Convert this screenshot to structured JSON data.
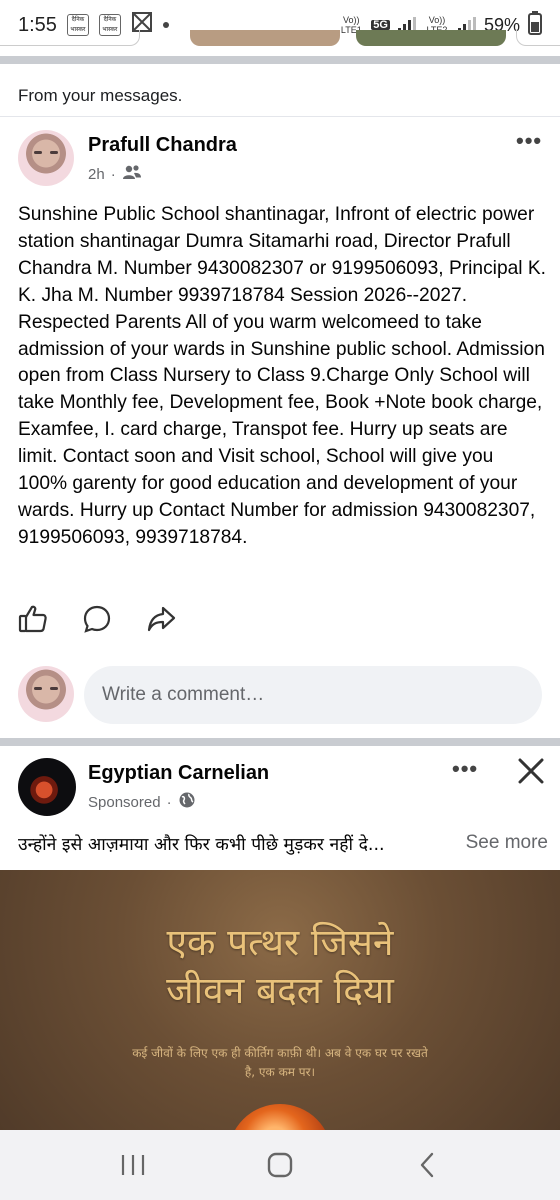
{
  "status_bar": {
    "time": "1:55",
    "notif_icon_1": "दैनिक भास्कर",
    "notif_icon_2": "दैनिक भास्कर",
    "sim1": "Vo)) LTE1",
    "network": "5G",
    "sim2": "Vo)) LTE2",
    "battery": "59%"
  },
  "post1": {
    "context_label": "From your messages.",
    "author": "Prafull Chandra",
    "time": "2h",
    "audience_icon": "friends-icon",
    "body": "Sunshine Public School shantinagar, Infront of electric power station shantinagar Dumra Sitamarhi road, Director Prafull Chandra M. Number 9430082307 or 9199506093, Principal K. K. Jha M. Number 9939718784 Session 2026--2027. Respected Parents All of you warm welcomeed to take admission of your wards in Sunshine public school. Admission open from Class Nursery to Class 9.Charge Only School will take Monthly fee, Development  fee, Book +Note book charge, Examfee, I. card charge, Transpot fee. Hurry up seats are limit. Contact soon and Visit school, School will give you 100% garenty for good education and development of your wards. Hurry up Contact Number for admission 9430082307, 9199506093, 9939718784.",
    "comment_placeholder": "Write a comment…"
  },
  "post2": {
    "author": "Egyptian Carnelian",
    "sponsored": "Sponsored",
    "audience_icon": "globe-icon",
    "text": "उन्होंने इसे आज़माया और फिर कभी पीछे मुड़कर नहीं दे...",
    "see_more": "See more",
    "ad_headline_1": "एक पत्थर जिसने",
    "ad_headline_2": "जीवन बदल दिया",
    "ad_sub_1": "कई जीवों के लिए एक ही कीर्तिग काफ़ी थी। अब वे एक घर पर रखते",
    "ad_sub_2": "है, एक कम पर।"
  },
  "colors": {
    "accent_text": "#050505",
    "muted": "#65676b",
    "divider": "#c9ccd1",
    "comment_bg": "#f0f2f5",
    "ad_gold": "#e9c27a"
  }
}
